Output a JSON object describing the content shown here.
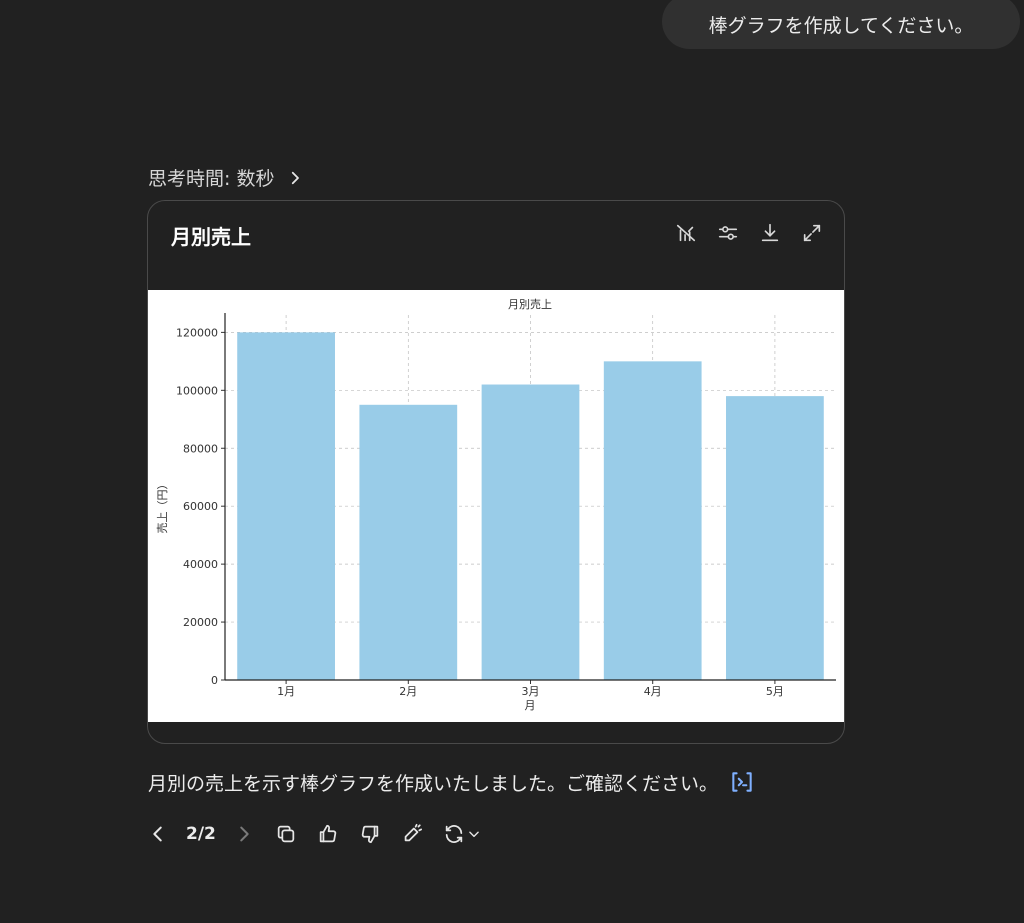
{
  "user_message": "棒グラフを作成してください。",
  "thinking_label": "思考時間: 数秒",
  "chart_card": {
    "title": "月別売上",
    "tools": [
      "chart-type-icon",
      "settings-sliders-icon",
      "download-icon",
      "expand-icon"
    ]
  },
  "chart_data": {
    "type": "bar",
    "title": "月別売上",
    "xlabel": "月",
    "ylabel": "売上（円）",
    "categories": [
      "1月",
      "2月",
      "3月",
      "4月",
      "5月"
    ],
    "values": [
      120000,
      95000,
      102000,
      110000,
      98000
    ],
    "ylim": [
      0,
      126000
    ],
    "yticks": [
      0,
      20000,
      40000,
      60000,
      80000,
      100000,
      120000
    ],
    "bar_color": "#99cce8",
    "grid": true
  },
  "answer_text": "月別の売上を示す棒グラフを作成いたしました。ご確認ください。",
  "pager": "2/2",
  "colors": {
    "background": "#212121",
    "bubble": "#303030",
    "accent_code": "#7fb0ff"
  }
}
